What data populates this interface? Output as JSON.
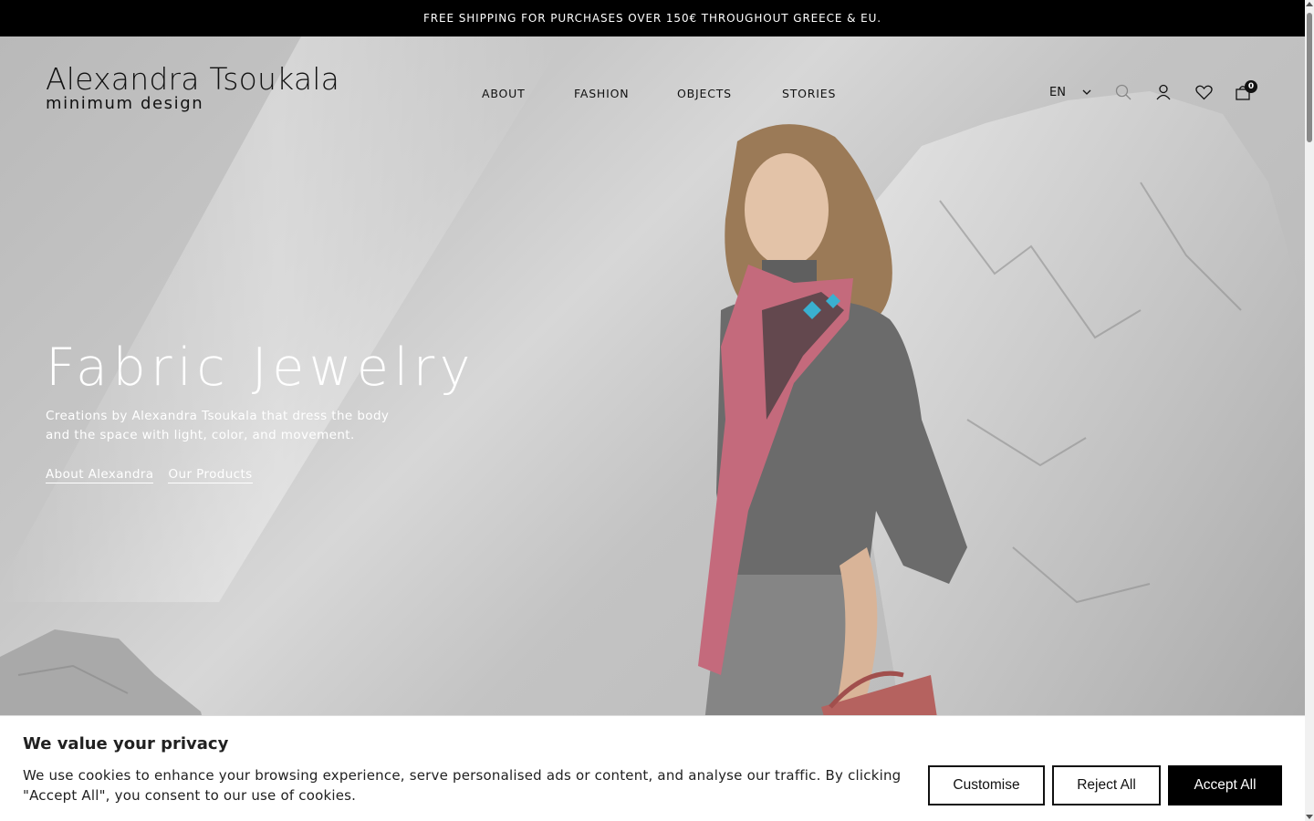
{
  "announcement": "FREE SHIPPING FOR PURCHASES OVER 150€ THROUGHOUT GREECE & EU.",
  "brand": {
    "name": "Alexandra Tsoukala",
    "tagline": "minimum design"
  },
  "nav": {
    "items": [
      {
        "label": "ABOUT"
      },
      {
        "label": "FASHION"
      },
      {
        "label": "OBJECTS"
      },
      {
        "label": "STORIES"
      }
    ]
  },
  "header": {
    "language": "EN",
    "cart_count": "0"
  },
  "hero": {
    "title": "Fabric Jewelry",
    "description": "Creations by Alexandra Tsoukala that dress the body and the space with light, color, and movement.",
    "link_about": "About Alexandra",
    "link_products": "Our Products"
  },
  "cookie_banner": {
    "title": "We value your privacy",
    "text": "We use cookies to enhance your browsing experience, serve personalised ads or content, and analyse our traffic. By clicking \"Accept All\", you consent to our use of cookies.",
    "customise_label": "Customise",
    "reject_label": "Reject All",
    "accept_label": "Accept All"
  },
  "colors": {
    "announcement_bg": "#000000",
    "accept_bg": "#000000",
    "scarf_pink": "#c46a7c",
    "sweater_grey": "#6b6b6b"
  },
  "icons": [
    "chevron-down-icon",
    "search-icon",
    "user-icon",
    "heart-icon",
    "bag-icon"
  ]
}
